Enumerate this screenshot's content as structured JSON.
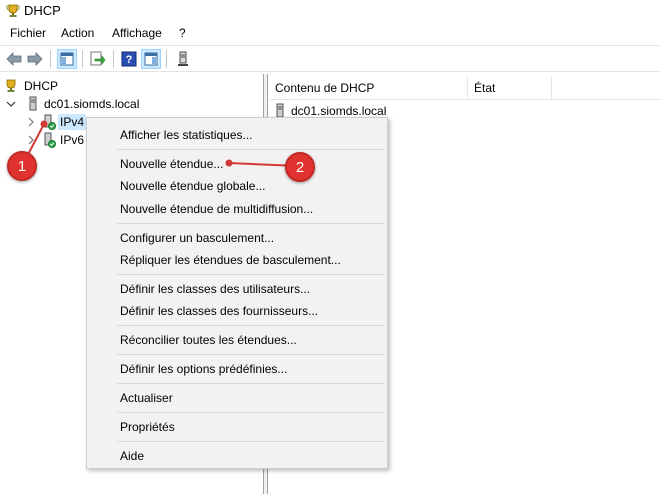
{
  "window": {
    "title": "DHCP",
    "icon": "dhcp-trophy-icon"
  },
  "menubar": {
    "items": [
      "Fichier",
      "Action",
      "Affichage",
      "?"
    ]
  },
  "toolbar": {
    "buttons": [
      "back-arrow-icon",
      "forward-arrow-icon",
      "show-hide-console-tree-icon",
      "export-list-icon",
      "help-icon",
      "show-hide-action-pane-icon",
      "server-icon"
    ]
  },
  "tree": {
    "root": "DHCP",
    "server": "dc01.siomds.local",
    "items": [
      {
        "label": "IPv4",
        "selected": true
      },
      {
        "label": "IPv6",
        "selected": false
      }
    ]
  },
  "list": {
    "columns": [
      "Contenu de DHCP",
      "État"
    ],
    "rows": [
      {
        "name": "dc01.siomds.local",
        "state": ""
      }
    ]
  },
  "context_menu": {
    "items": [
      "Afficher les statistiques...",
      "Nouvelle étendue...",
      "Nouvelle étendue globale...",
      "Nouvelle étendue de multidiffusion...",
      "Configurer un basculement...",
      "Répliquer les étendues de basculement...",
      "Définir les classes des utilisateurs...",
      "Définir les classes des fournisseurs...",
      "Réconcilier toutes les étendues...",
      "Définir les options prédéfinies...",
      "Actualiser",
      "Propriétés",
      "Aide"
    ]
  },
  "annotations": {
    "badge_1": "1",
    "badge_2": "2",
    "color": "#e0332f"
  }
}
